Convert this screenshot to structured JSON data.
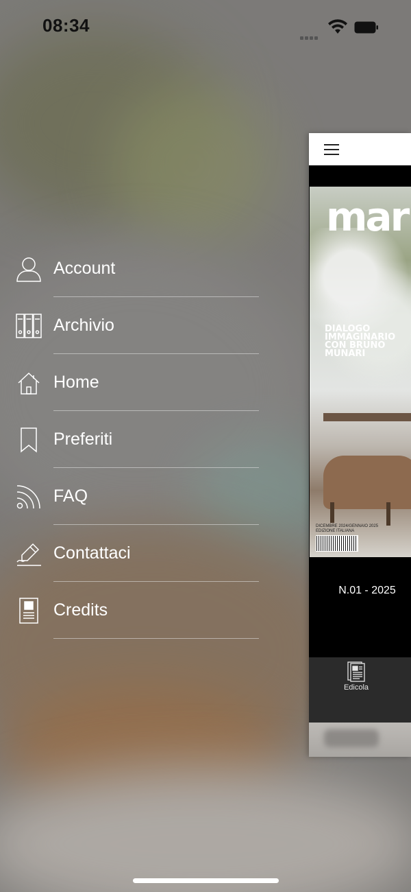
{
  "status_bar": {
    "time": "08:34"
  },
  "menu": {
    "items": [
      {
        "label": "Account",
        "icon": "user-icon"
      },
      {
        "label": "Archivio",
        "icon": "archive-binders-icon"
      },
      {
        "label": "Home",
        "icon": "home-icon"
      },
      {
        "label": "Preferiti",
        "icon": "bookmark-icon"
      },
      {
        "label": "FAQ",
        "icon": "rss-icon"
      },
      {
        "label": "Contattaci",
        "icon": "pen-signature-icon"
      },
      {
        "label": "Credits",
        "icon": "id-card-icon"
      }
    ]
  },
  "preview": {
    "masthead": "mar",
    "headline": "DIALOGO IMMAGINARIO CON BRUNO MUNARI",
    "fineprint_1": "DICEMBRE 2024/GENNAIO 2025",
    "fineprint_2": "EDIZIONE ITALIANA",
    "issue_label": "N.01 - 2025",
    "tab_label": "Edicola",
    "tab_icon": "newspaper-icon"
  },
  "colors": {
    "menu_text": "#ffffff",
    "separator": "#e6e6e6",
    "tabbar": "#2b2b2b"
  }
}
